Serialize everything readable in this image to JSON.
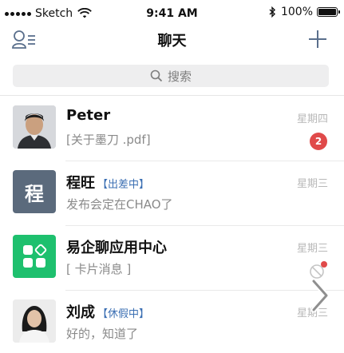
{
  "status_bar": {
    "carrier": "Sketch",
    "time": "9:41 AM",
    "battery": "100%",
    "icons": [
      "signal-dots-icon",
      "wifi-icon",
      "bluetooth-icon",
      "battery-icon"
    ]
  },
  "nav": {
    "title": "聊天",
    "left_icon": "contacts-icon",
    "right_icon": "add-icon"
  },
  "search": {
    "placeholder": "搜索",
    "icon": "search-icon"
  },
  "chats": [
    {
      "name": "Peter",
      "tag": "",
      "message": "[关于墨刀 .pdf]",
      "time": "星期四",
      "unread": "2",
      "avatar": "photo-man"
    },
    {
      "name": "程旺",
      "tag": "【出差中】",
      "message": "发布会定在CHAO了",
      "time": "星期三",
      "unread": "",
      "avatar_text": "程"
    },
    {
      "name": "易企聊应用中心",
      "tag": "",
      "message": "[ 卡片消息 ]",
      "time": "星期三",
      "unread": "",
      "avatar": "app-grid-icon"
    },
    {
      "name": "刘成",
      "tag": "【休假中】",
      "message": "好的，知道了",
      "time": "星期三",
      "unread": "",
      "avatar": "photo-woman"
    }
  ],
  "colors": {
    "accent_blue": "#3b6fb3",
    "badge_red": "#e04a4a",
    "app_green": "#1ec06e",
    "avatar_slate": "#5b6a7c"
  }
}
